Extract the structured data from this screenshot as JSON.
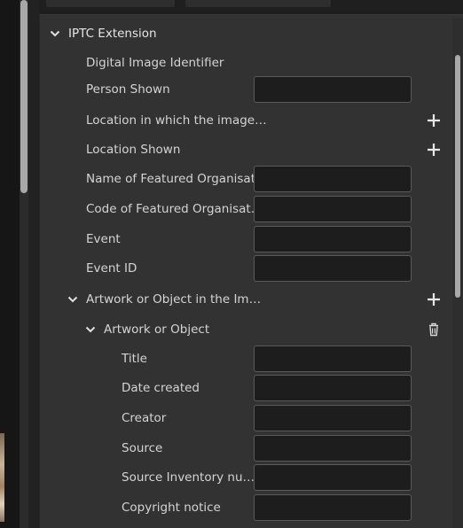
{
  "section": {
    "title": "IPTC Extension",
    "expanded": true
  },
  "fields": {
    "digital_image_identifier": "Digital Image Identifier",
    "person_shown": "Person Shown",
    "location_created": "Location in which the image…",
    "location_shown": "Location Shown",
    "name_featured_org": "Name of Featured Organisat…",
    "code_featured_org": "Code of Featured Organisat…",
    "event": "Event",
    "event_id": "Event ID"
  },
  "artwork_group": {
    "label": "Artwork or Object in the Im…",
    "item_label": "Artwork or Object",
    "fields": {
      "title": "Title",
      "date_created": "Date created",
      "creator": "Creator",
      "source": "Source",
      "source_inventory": "Source Inventory nu…",
      "copyright_notice": "Copyright notice"
    }
  },
  "values": {
    "person_shown": "",
    "name_featured_org": "",
    "code_featured_org": "",
    "event": "",
    "event_id": "",
    "art_title": "",
    "art_date_created": "",
    "art_creator": "",
    "art_source": "",
    "art_source_inventory": "",
    "art_copyright_notice": ""
  },
  "icons": {
    "add": "plus-icon",
    "delete": "trash-icon",
    "expand": "chevron-down-icon"
  },
  "colors": {
    "panel_bg": "#323232",
    "field_bg": "#1d1d1d",
    "field_border": "#5a5a5a",
    "text": "#d4d4d4"
  }
}
